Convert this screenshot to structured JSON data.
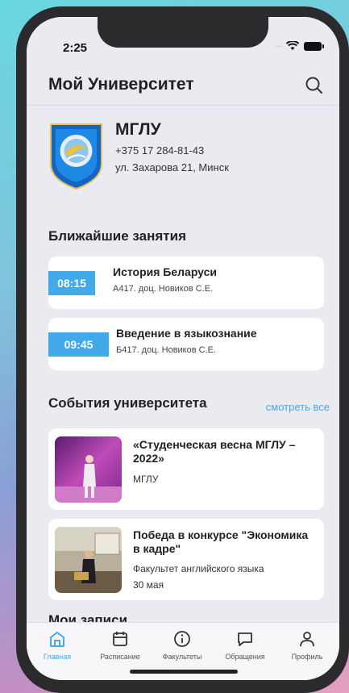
{
  "status_bar": {
    "time": "2:25"
  },
  "header": {
    "title": "Мой Университет",
    "search_icon": "search-icon"
  },
  "university": {
    "name": "МГЛУ",
    "phone": "+375 17 284-81-43",
    "address": "ул. Захарова 21, Минск"
  },
  "lessons_section": {
    "title": "Ближайшие занятия",
    "items": [
      {
        "time": "08:15",
        "name": "История Беларуси",
        "details": "А417. доц. Новиков С.Е."
      },
      {
        "time": "09:45",
        "name": "Введение в языкознание",
        "details": "Б417. доц. Новиков С.Е."
      }
    ]
  },
  "events_section": {
    "title": "События университета",
    "see_all": "смотреть все",
    "items": [
      {
        "title": "«Студенческая весна МГЛУ – 2022»",
        "subtitle": "МГЛУ",
        "date": ""
      },
      {
        "title": "Победа в конкурсе \"Экономика в кадре\"",
        "subtitle": "Факультет английского языка",
        "date": "30 мая"
      }
    ]
  },
  "next_section": {
    "title": "Мои записи"
  },
  "tabbar": {
    "items": [
      {
        "label": "Главная",
        "icon": "home-icon",
        "active": true
      },
      {
        "label": "Расписание",
        "icon": "calendar-icon",
        "active": false
      },
      {
        "label": "Факультеты",
        "icon": "info-icon",
        "active": false
      },
      {
        "label": "Обращения",
        "icon": "chat-icon",
        "active": false
      },
      {
        "label": "Профиль",
        "icon": "user-icon",
        "active": false
      }
    ]
  },
  "colors": {
    "accent": "#43aaea",
    "background": "#e9ebf0",
    "card": "#ffffff"
  }
}
